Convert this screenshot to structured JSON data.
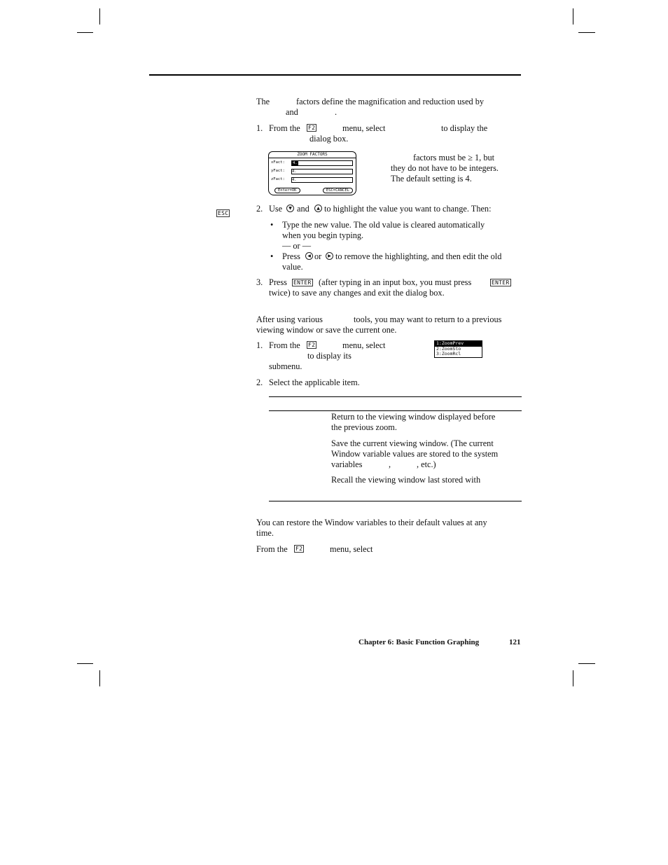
{
  "intro": {
    "w1": "The",
    "w2": "factors define the magnification and reduction used by",
    "w3": "and",
    "w4": "."
  },
  "step1a": {
    "num": "1.",
    "a": "From the",
    "key": "F2",
    "b": "menu, select",
    "c": "to display the",
    "d": "dialog box."
  },
  "dialog": {
    "title": "ZOOM FACTORS",
    "rows": [
      {
        "label": "xFact:",
        "value": "4."
      },
      {
        "label": "yFact:",
        "value": "4."
      },
      {
        "label": "zFact:",
        "value": "4."
      }
    ],
    "ok": "Enter=OK",
    "cancel": "ESC=CANCEL"
  },
  "note": {
    "l1": "factors must be ≥ 1, but",
    "l2": "they do not have to be integers.",
    "l3": "The default setting is 4."
  },
  "margin_key": "ESC",
  "step2a": {
    "num": "2.",
    "a": "Use",
    "and": "and",
    "b": "to highlight the value you want to change. Then:",
    "down_icon": "down-arrow-icon",
    "up_icon": "up-arrow-icon"
  },
  "bullets": {
    "b1l1": "Type the new value. The old value is cleared automatically",
    "b1l2": "when you begin typing.",
    "or": "— or —",
    "b2a": "Press",
    "b2or": "or",
    "b2b": "to remove the highlighting, and then edit the old",
    "b2l2": "value.",
    "dot": "•"
  },
  "step3a": {
    "num": "3.",
    "a": "Press",
    "key": "ENTER",
    "b": "(after typing in an input box, you must press",
    "l2": "twice) to save any changes and exit the dialog box."
  },
  "section2": {
    "l1a": "After using various",
    "l1b": "tools, you may want to return to a previous",
    "l2": "viewing window or save the current one."
  },
  "step1b": {
    "num": "1.",
    "a": "From the",
    "key": "F2",
    "b": "menu, select",
    "c": "to display its",
    "d": "submenu."
  },
  "menu": [
    "1:ZoomPrev",
    "2:ZoomSto",
    "3:ZoomRcl"
  ],
  "step2b": {
    "num": "2.",
    "a": "Select the applicable item."
  },
  "table": {
    "r1l1": "Return to the viewing window displayed before",
    "r1l2": "the previous zoom.",
    "r2l1": "Save the current viewing window. (The current",
    "r2l2": "Window variable values are stored to the system",
    "r2l3a": "variables",
    "r2l3b": ",",
    "r2l3c": ", etc.)",
    "r3l1": "Recall the viewing window last stored with"
  },
  "section3": {
    "l1": "You can restore the Window variables to their default values at any",
    "l2": "time.",
    "a": "From the",
    "key": "F2",
    "b": "menu, select"
  },
  "footer": {
    "chapter": "Chapter 6: Basic Function Graphing",
    "page": "121"
  }
}
